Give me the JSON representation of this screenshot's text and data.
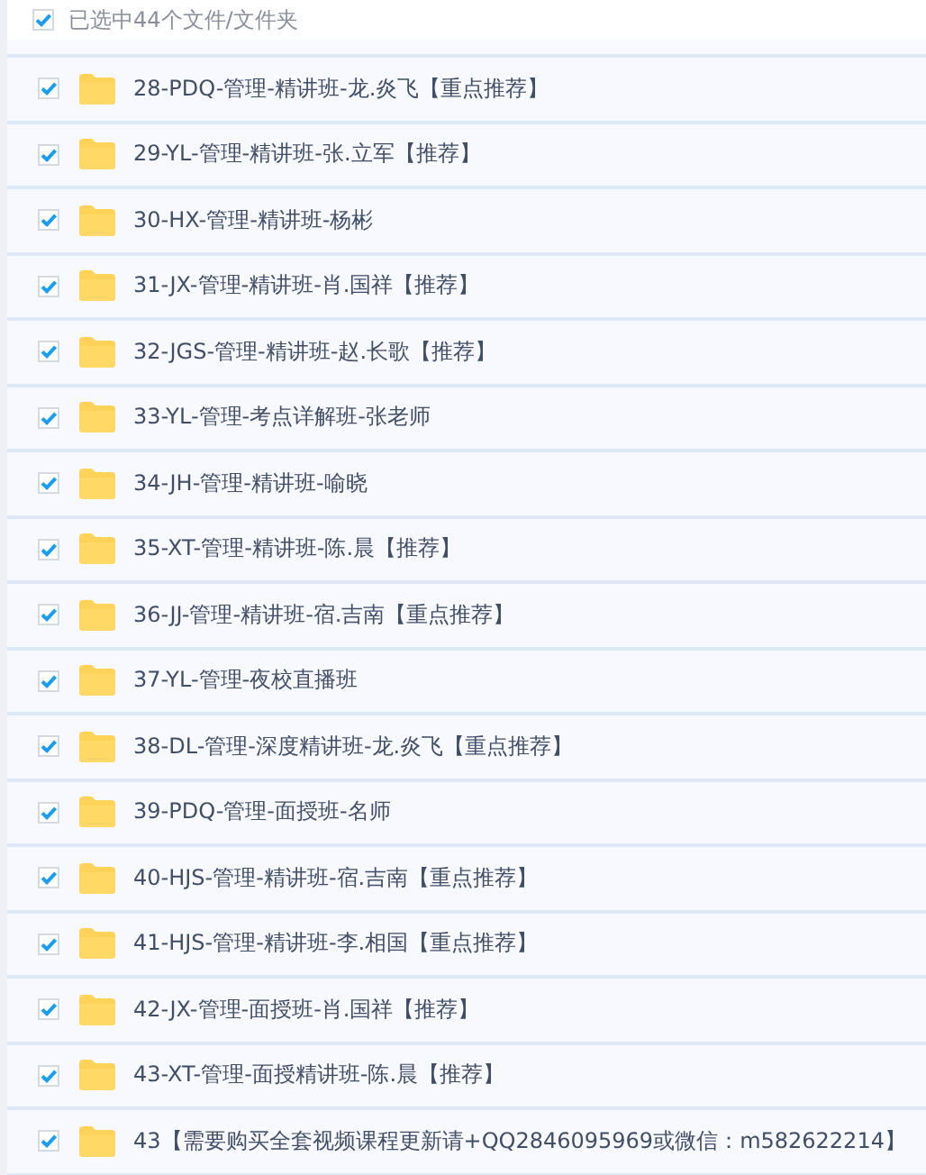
{
  "header": {
    "checked": true,
    "label": "已选中44个文件/文件夹"
  },
  "files": [
    {
      "name": "28-PDQ-管理-精讲班-龙.炎飞【重点推荐】",
      "checked": true
    },
    {
      "name": "29-YL-管理-精讲班-张.立军【推荐】",
      "checked": true
    },
    {
      "name": "30-HX-管理-精讲班-杨彬",
      "checked": true
    },
    {
      "name": "31-JX-管理-精讲班-肖.国祥【推荐】",
      "checked": true
    },
    {
      "name": "32-JGS-管理-精讲班-赵.长歌【推荐】",
      "checked": true
    },
    {
      "name": "33-YL-管理-考点详解班-张老师",
      "checked": true
    },
    {
      "name": "34-JH-管理-精讲班-喻晓",
      "checked": true
    },
    {
      "name": "35-XT-管理-精讲班-陈.晨【推荐】",
      "checked": true
    },
    {
      "name": "36-JJ-管理-精讲班-宿.吉南【重点推荐】",
      "checked": true
    },
    {
      "name": "37-YL-管理-夜校直播班",
      "checked": true
    },
    {
      "name": "38-DL-管理-深度精讲班-龙.炎飞【重点推荐】",
      "checked": true
    },
    {
      "name": "39-PDQ-管理-面授班-名师",
      "checked": true
    },
    {
      "name": "40-HJS-管理-精讲班-宿.吉南【重点推荐】",
      "checked": true
    },
    {
      "name": "41-HJS-管理-精讲班-李.相国【重点推荐】",
      "checked": true
    },
    {
      "name": "42-JX-管理-面授班-肖.国祥【推荐】",
      "checked": true
    },
    {
      "name": "43-XT-管理-面授精讲班-陈.晨【推荐】",
      "checked": true
    },
    {
      "name": "43【需要购买全套视频课程更新请+QQ2846095969或微信：m582622214】",
      "checked": true
    }
  ]
}
